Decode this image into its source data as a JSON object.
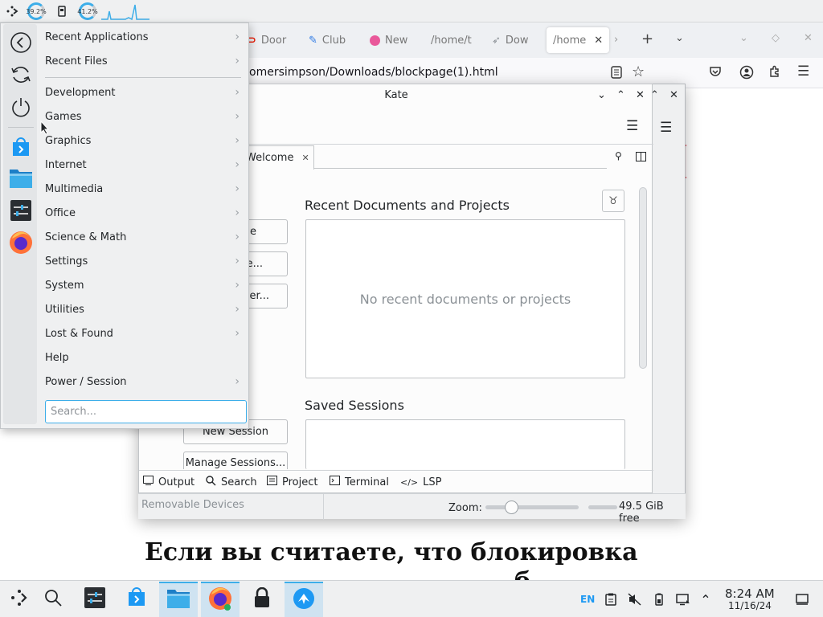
{
  "top_strip": {
    "cpu_label": "39.2%",
    "mem_label": "41.2%",
    "cpu_fraction": 0.39,
    "mem_fraction": 0.41
  },
  "firefox": {
    "tabs": [
      {
        "label": "Door",
        "icon": "doordash-icon"
      },
      {
        "label": "Club",
        "icon": "clubhouse-icon"
      },
      {
        "label": "New",
        "icon": "new-tab-icon"
      },
      {
        "label": "/home/t",
        "icon": ""
      },
      {
        "label": "Dow",
        "icon": "downloads-icon"
      },
      {
        "label": "/home",
        "icon": "",
        "active": true
      }
    ],
    "url": "omersimpson/Downloads/blockpage(1).html",
    "page_heading_line1": "Если вы считаете, что блокировка",
    "page_heading_line2": "б"
  },
  "kate": {
    "title": "Kate",
    "open_label": "en",
    "tab_label": "Welcome",
    "recent_heading": "Recent Documents and Projects",
    "recent_empty": "No recent documents or projects",
    "saved_heading": "Saved Sessions",
    "buttons": [
      "le",
      "e...",
      "der...",
      "New Session",
      "Manage Sessions..."
    ],
    "bottom_tools": [
      {
        "label": "Output",
        "icon": "output-icon"
      },
      {
        "label": "Search",
        "icon": "search-icon"
      },
      {
        "label": "Project",
        "icon": "project-icon"
      },
      {
        "label": "Terminal",
        "icon": "terminal-icon"
      },
      {
        "label": "LSP",
        "icon": "lsp-icon"
      }
    ]
  },
  "dolphin_status": {
    "removable_label": "Removable Devices",
    "zoom_label": "Zoom:",
    "free_label": "49.5 GiB free",
    "zoom_fraction": 0.1
  },
  "menu": {
    "side_icons": [
      "back-icon",
      "refresh-icon",
      "power-icon",
      "discover-icon",
      "dolphin-icon",
      "system-settings-icon",
      "firefox-icon"
    ],
    "items": [
      {
        "label": "Recent Applications",
        "submenu": true
      },
      {
        "label": "Recent Files",
        "submenu": true
      },
      {
        "label": "Development",
        "submenu": true
      },
      {
        "label": "Games",
        "submenu": true
      },
      {
        "label": "Graphics",
        "submenu": true
      },
      {
        "label": "Internet",
        "submenu": true
      },
      {
        "label": "Multimedia",
        "submenu": true
      },
      {
        "label": "Office",
        "submenu": true
      },
      {
        "label": "Science & Math",
        "submenu": true
      },
      {
        "label": "Settings",
        "submenu": true
      },
      {
        "label": "System",
        "submenu": true
      },
      {
        "label": "Utilities",
        "submenu": true
      },
      {
        "label": "Lost & Found",
        "submenu": true
      },
      {
        "label": "Help",
        "submenu": false
      },
      {
        "label": "Power / Session",
        "submenu": true
      }
    ],
    "search_placeholder": "Search..."
  },
  "taskbar": {
    "tasks": [
      "launcher-icon",
      "search-icon",
      "system-settings-icon",
      "discover-icon",
      "dolphin-icon",
      "firefox-icon",
      "lock-icon",
      "kate-icon"
    ],
    "tray_lang": "EN",
    "time": "8:24 AM",
    "date": "11/16/24"
  },
  "colors": {
    "accent": "#3daee9",
    "panel": "#eff0f1",
    "error_red": "#da4453"
  }
}
